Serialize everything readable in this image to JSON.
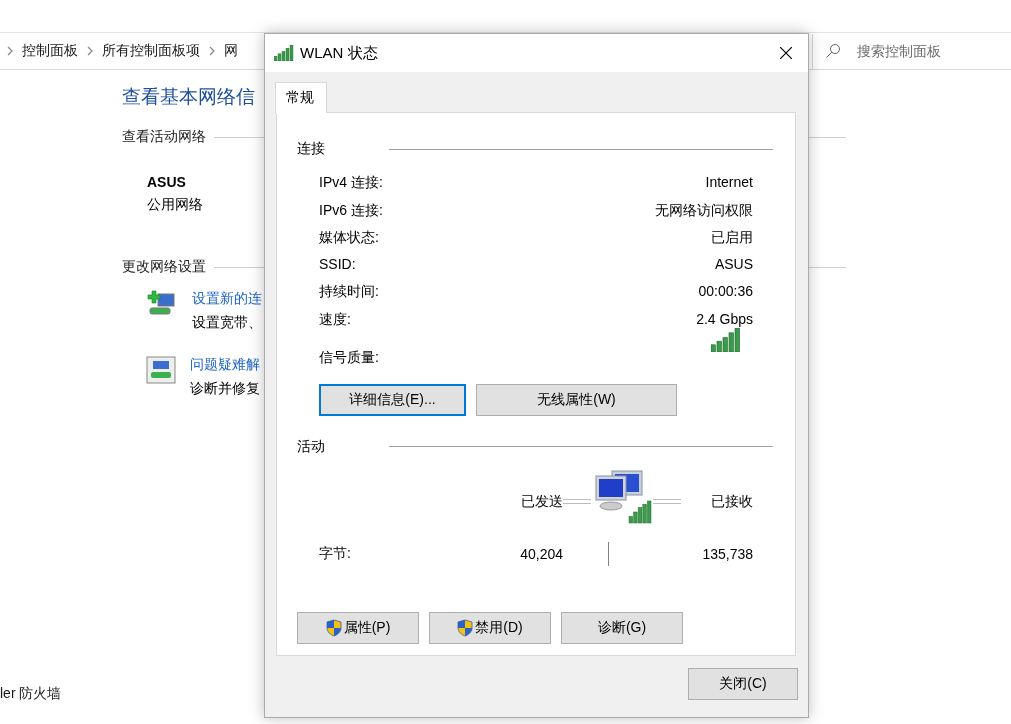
{
  "background": {
    "breadcrumb": [
      "控制面板",
      "所有控制面板项",
      "网"
    ],
    "search": {
      "placeholder": "搜索控制面板"
    },
    "title": "查看基本网络信",
    "active_networks": {
      "heading": "查看活动网络",
      "name": "ASUS",
      "category": "公用网络"
    },
    "change_settings": {
      "heading": "更改网络设置",
      "tasks": [
        {
          "kind": "new-connection",
          "link": "设置新的连",
          "description": "设置宽带、"
        },
        {
          "kind": "troubleshoot",
          "link": "问题疑难解",
          "description": "诊断并修复"
        }
      ]
    },
    "footer_link": "ler 防火墙"
  },
  "dialog": {
    "title": "WLAN 状态",
    "tabs": [
      {
        "label": "常规",
        "selected": true
      }
    ],
    "connection": {
      "heading": "连接",
      "rows": [
        {
          "label": "IPv4 连接:",
          "value": "Internet"
        },
        {
          "label": "IPv6 连接:",
          "value": "无网络访问权限"
        },
        {
          "label": "媒体状态:",
          "value": "已启用"
        },
        {
          "label": "SSID:",
          "value": "ASUS"
        },
        {
          "label": "持续时间:",
          "value": "00:00:36"
        },
        {
          "label": "速度:",
          "value": "2.4 Gbps"
        }
      ],
      "signal_label": "信号质量:"
    },
    "buttons": [
      {
        "label": "详细信息(E)...",
        "focused": true
      },
      {
        "label": "无线属性(W)",
        "focused": false
      }
    ],
    "activity": {
      "heading": "活动",
      "sent_label": "已发送",
      "received_label": "已接收",
      "bytes_label": "字节:",
      "sent": "40,204",
      "received": "135,738"
    },
    "action_buttons": [
      {
        "label": "属性(P)",
        "shield": true
      },
      {
        "label": "禁用(D)",
        "shield": true
      },
      {
        "label": "诊断(G)",
        "shield": false
      }
    ],
    "close_button": "关闭(C)"
  }
}
